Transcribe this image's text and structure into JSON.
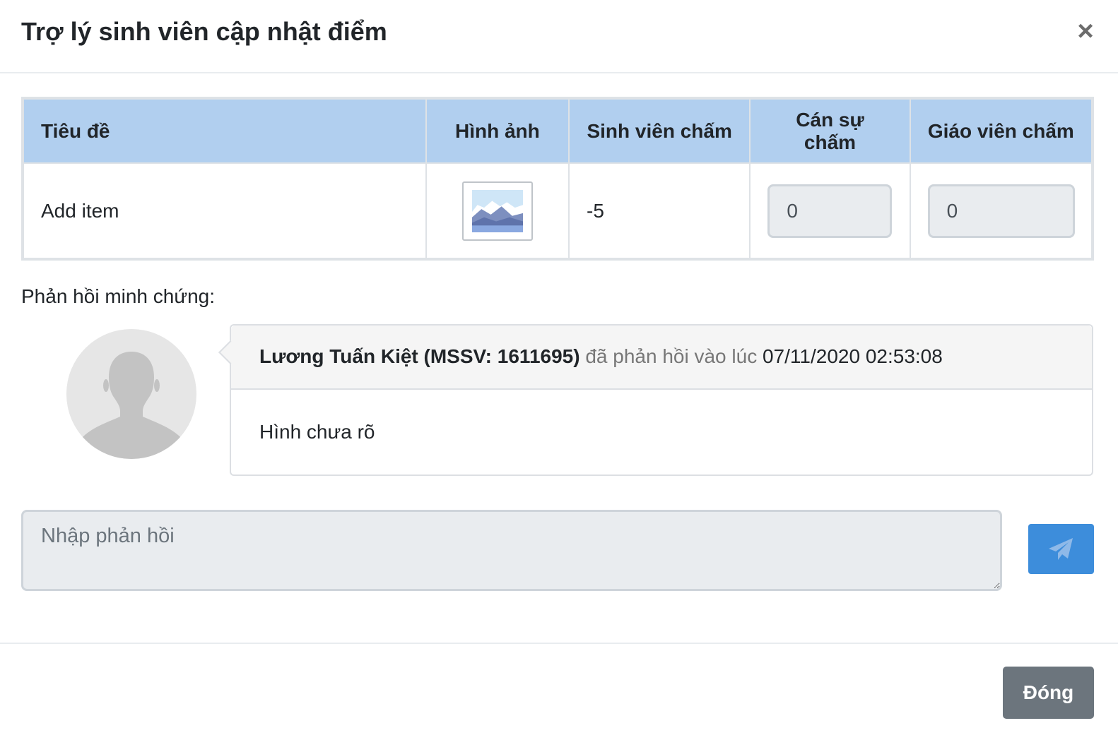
{
  "modal": {
    "title": "Trợ lý sinh viên cập nhật điểm",
    "close_icon": "close-icon"
  },
  "table": {
    "headers": [
      "Tiêu đề",
      "Hình ảnh",
      "Sinh viên chấm",
      "Cán sự chấm",
      "Giáo viên chấm"
    ],
    "rows": [
      {
        "title": "Add item",
        "image_icon": "image-thumbnail-icon",
        "student_score": "-5",
        "monitor_score": "0",
        "teacher_score": "0"
      }
    ]
  },
  "feedback": {
    "label": "Phản hồi minh chứng:",
    "comments": [
      {
        "avatar_icon": "default-avatar-icon",
        "author": "Lương Tuấn Kiệt (MSSV: 1611695)",
        "action_text": "đã phản hồi vào lúc",
        "timestamp": "07/11/2020 02:53:08",
        "body": "Hình chưa rõ"
      }
    ]
  },
  "reply": {
    "placeholder": "Nhập phản hồi",
    "send_icon": "paper-plane-icon"
  },
  "footer": {
    "close_label": "Đóng"
  },
  "colors": {
    "table_header_bg": "#b1cfef",
    "send_button": "#3d8ddb",
    "close_button": "#6c757d"
  }
}
